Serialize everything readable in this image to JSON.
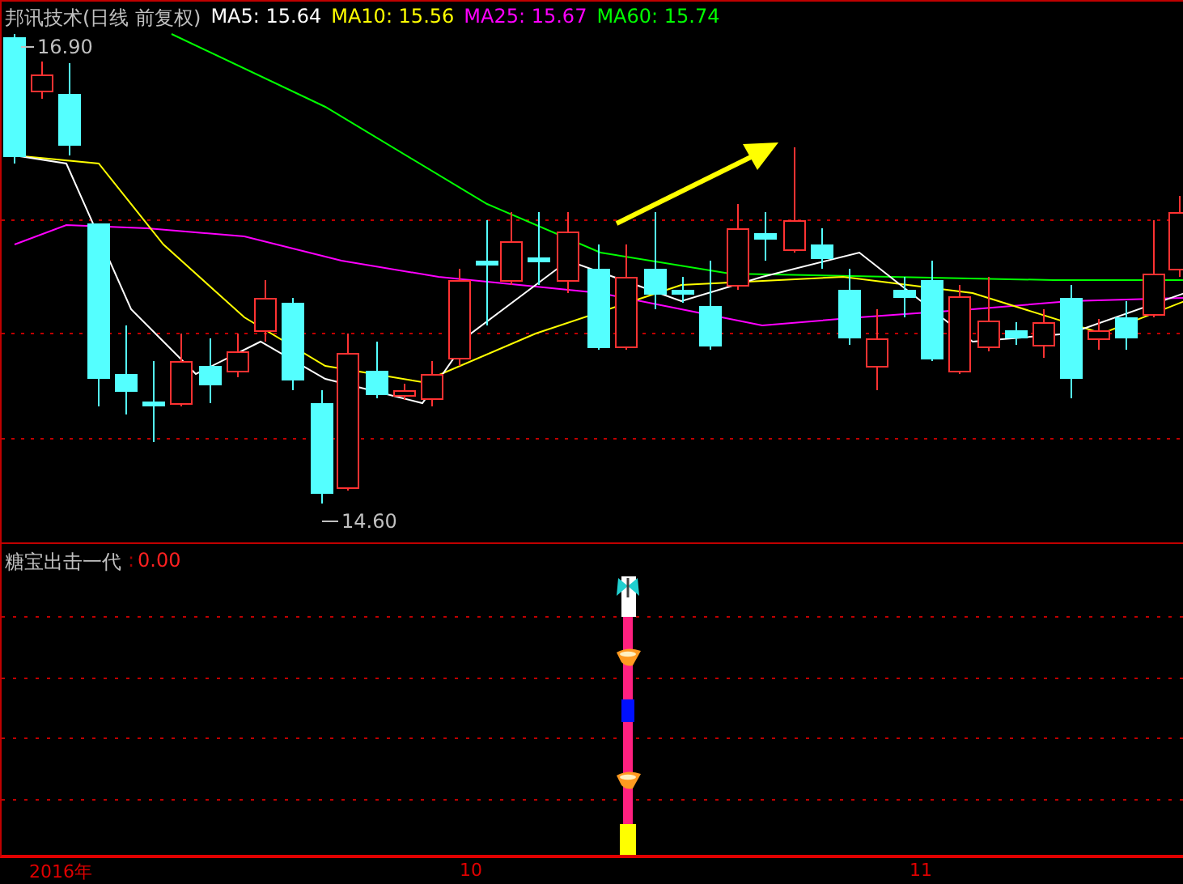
{
  "title": "邦讯技术(日线 前复权)",
  "ma_legend": [
    {
      "label": "MA5: 15.64",
      "color": "#ffffff"
    },
    {
      "label": "MA10: 15.56",
      "color": "#ffff00"
    },
    {
      "label": "MA25: 15.67",
      "color": "#ff00ff"
    },
    {
      "label": "MA60: 15.74",
      "color": "#00ff00"
    }
  ],
  "high_label": "16.90",
  "low_label": "14.60",
  "indicator": {
    "name": "糖宝出击一代",
    "separator": ":",
    "value": "0.00"
  },
  "x_axis": [
    "2016年",
    "10",
    "11"
  ]
}
